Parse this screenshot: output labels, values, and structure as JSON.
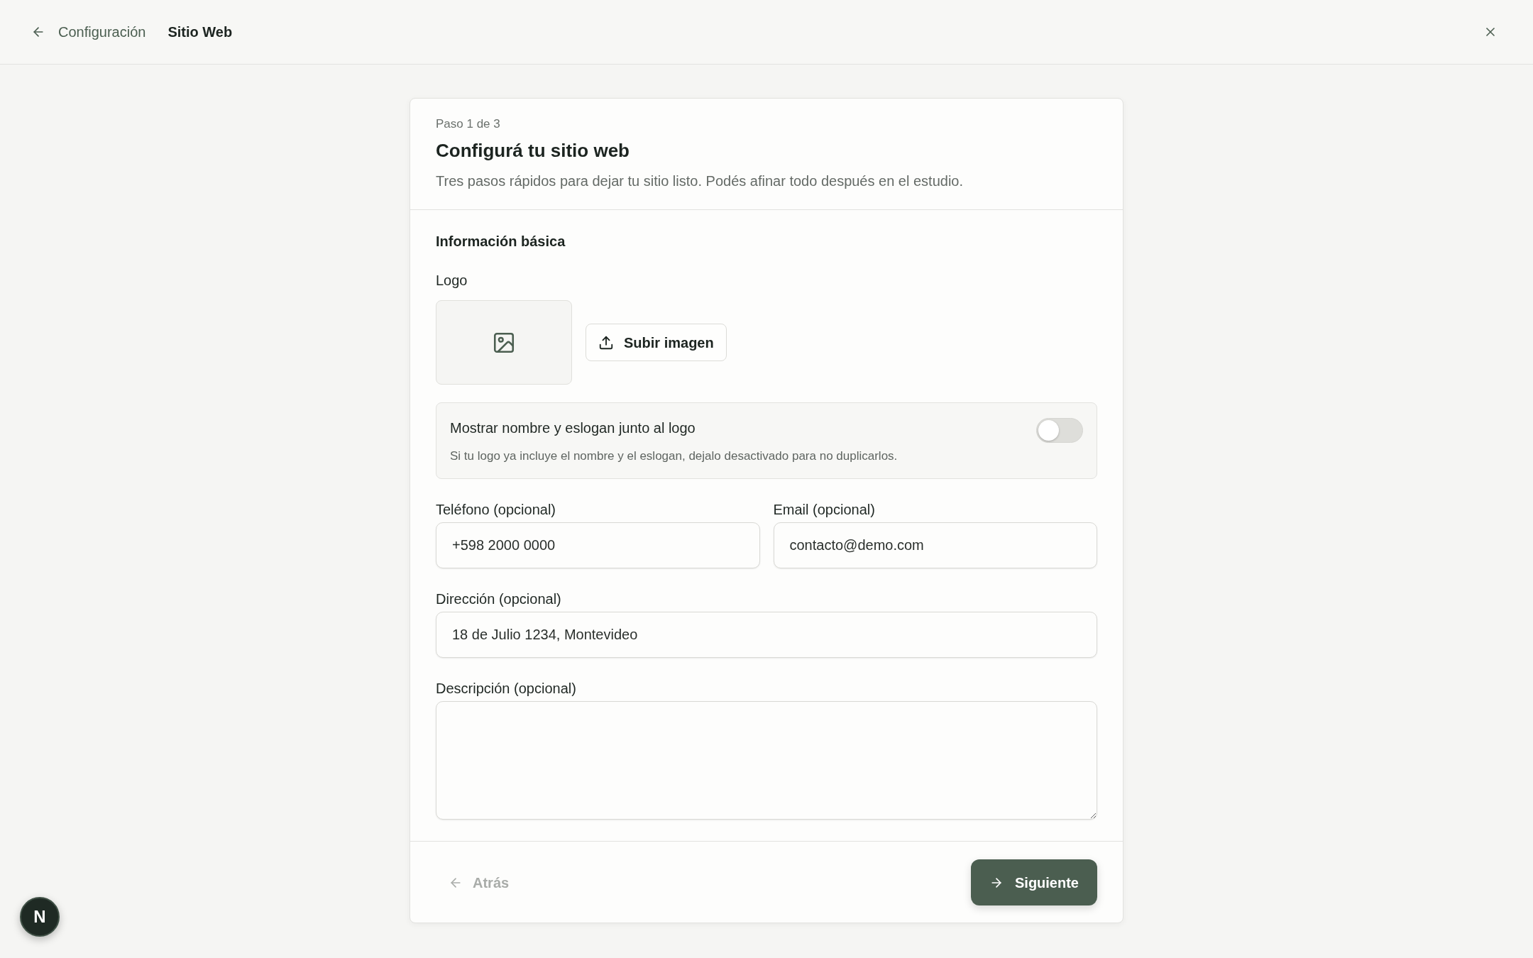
{
  "header": {
    "back_link": "Configuración",
    "title": "Sitio Web"
  },
  "wizard": {
    "step": "Paso 1 de 3",
    "title": "Configurá tu sitio web",
    "subtitle": "Tres pasos rápidos para dejar tu sitio listo. Podés afinar todo después en el estudio.",
    "section_title": "Información básica",
    "logo": {
      "label": "Logo",
      "upload_button": "Subir imagen"
    },
    "toggle": {
      "label": "Mostrar nombre y eslogan junto al logo",
      "hint": "Si tu logo ya incluye el nombre y el eslogan, dejalo desactivado para no duplicarlos.",
      "on": false
    },
    "field_rows": [
      [
        {
          "kind": "input",
          "label": "Teléfono (opcional)",
          "value": "+598 2000 0000"
        },
        {
          "kind": "input",
          "label": "Email (opcional)",
          "value": "contacto@demo.com"
        }
      ],
      [
        {
          "kind": "input",
          "label": "Dirección (opcional)",
          "value": "18 de Julio 1234, Montevideo"
        }
      ],
      [
        {
          "kind": "textarea",
          "label": "Descripción (opcional)"
        }
      ]
    ],
    "footer": {
      "back_button": {
        "label": "Atrás",
        "disabled": true
      },
      "next_button": {
        "label": "Siguiente"
      }
    }
  },
  "dev_badge": {
    "label": "N"
  }
}
